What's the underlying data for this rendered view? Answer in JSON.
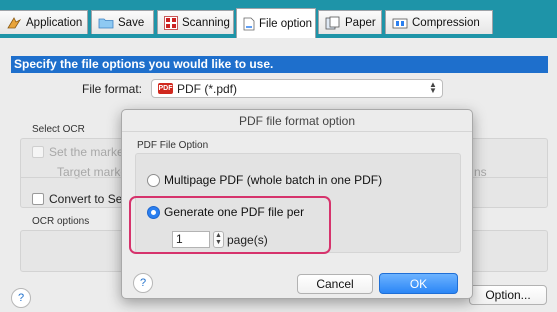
{
  "tabs": [
    {
      "label": "Application",
      "icon": "application-icon"
    },
    {
      "label": "Save",
      "icon": "folder-icon"
    },
    {
      "label": "Scanning",
      "icon": "scanning-icon"
    },
    {
      "label": "File option",
      "icon": "file-icon"
    },
    {
      "label": "Paper",
      "icon": "paper-icon"
    },
    {
      "label": "Compression",
      "icon": "compression-icon"
    }
  ],
  "active_tab": "File option",
  "main": {
    "header": "Specify the file options you would like to use.",
    "file_format_label": "File format:",
    "file_format_value": "PDF (*.pdf)",
    "file_format_badge": "PDF",
    "select_ocr_label": "Select OCR",
    "set_marked_label": "Set the marked",
    "target_marked_label": "Target marke",
    "target_suffix": "ns",
    "convert_label": "Convert to Sea",
    "ocr_options_label": "OCR options",
    "option_button": "Option..."
  },
  "dialog": {
    "title": "PDF file format option",
    "group_label": "PDF File Option",
    "radio_multipage": "Multipage PDF (whole batch in one PDF)",
    "radio_one_per": "Generate one PDF file per",
    "selected": "Generate one PDF file per",
    "pages_value": "1",
    "pages_label": "page(s)",
    "cancel_label": "Cancel",
    "ok_label": "OK"
  },
  "colors": {
    "tabbar_bg": "#1e94a8",
    "header_bg": "#1e6fcc",
    "highlight": "#d6336c",
    "ok_button": "#2b86f6"
  }
}
